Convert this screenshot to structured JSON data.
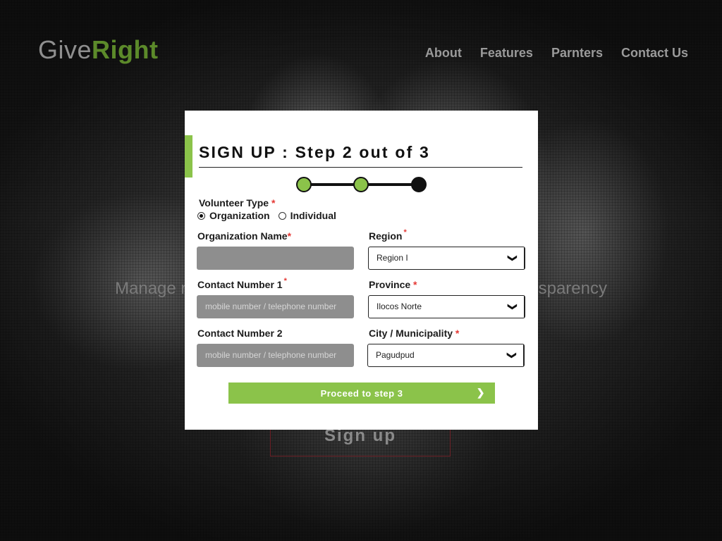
{
  "brand": {
    "part1": "Give",
    "part2": "Right"
  },
  "nav": [
    "About",
    "Features",
    "Parnters",
    "Contact Us"
  ],
  "hero": {
    "left_text": "Manage r",
    "right_text": "sparency",
    "button": "Sign up"
  },
  "modal": {
    "title": "SIGN UP : Step 2 out of 3",
    "stepper": {
      "current": 3,
      "total": 3,
      "completed": 2
    },
    "volunteer_type": {
      "label": "Volunteer Type",
      "required_mark": "*",
      "options": [
        "Organization",
        "Individual"
      ],
      "selected": "Organization"
    },
    "org_name": {
      "label": "Organization Name",
      "required_mark": "*",
      "value": ""
    },
    "region": {
      "label": "Region",
      "required_mark": "*",
      "value": "Region I"
    },
    "contact1": {
      "label": "Contact Number 1",
      "required_mark": "*",
      "placeholder": "mobile number / telephone number"
    },
    "province": {
      "label": "Province",
      "required_mark": "*",
      "value": "Ilocos Norte"
    },
    "contact2": {
      "label": "Contact Number 2",
      "placeholder": "mobile number / telephone number"
    },
    "city": {
      "label": "City / Municipality",
      "required_mark": "*",
      "value": "Pagudpud"
    },
    "proceed": {
      "label": "Proceed to step 3",
      "arrow": "❯"
    }
  },
  "icons": {
    "select_caret": "chevron-down-icon",
    "proceed_arrow": "chevron-right-icon"
  },
  "colors": {
    "accent": "#8bc34a",
    "brand_green": "#5c8a2a",
    "required": "#e53935"
  }
}
